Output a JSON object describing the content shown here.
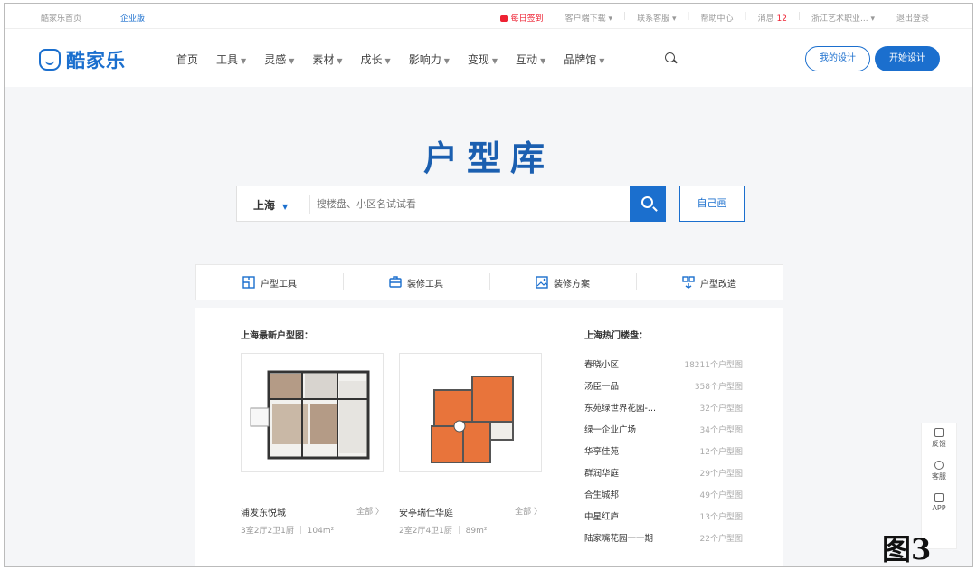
{
  "topbar": {
    "home_link": "酷家乐首页",
    "enterprise": "企业版",
    "signin": "每日签到",
    "client_download": "客户端下载",
    "contact_us": "联系客服",
    "help_center": "帮助中心",
    "messages": "消息",
    "message_count": "12",
    "account": "浙江艺术职业...",
    "logout": "退出登录"
  },
  "nav": {
    "brand": "酷家乐",
    "menu": [
      {
        "label": "首页"
      },
      {
        "label": "工具",
        "dropdown": true
      },
      {
        "label": "灵感",
        "dropdown": true
      },
      {
        "label": "素材",
        "dropdown": true
      },
      {
        "label": "成长",
        "dropdown": true
      },
      {
        "label": "影响力",
        "dropdown": true
      },
      {
        "label": "变现",
        "dropdown": true
      },
      {
        "label": "互动",
        "dropdown": true
      },
      {
        "label": "品牌馆",
        "dropdown": true
      }
    ],
    "my_design": "我的设计",
    "start_design": "开始设计"
  },
  "hero": {
    "title": "户型库",
    "city": "上海",
    "search_placeholder": "搜楼盘、小区名试试看",
    "self_draw": "自己画"
  },
  "tools": [
    {
      "label": "户型工具",
      "icon": "floorplan-icon"
    },
    {
      "label": "装修工具",
      "icon": "toolbox-icon"
    },
    {
      "label": "装修方案",
      "icon": "image-icon"
    },
    {
      "label": "户型改造",
      "icon": "renovate-icon"
    }
  ],
  "latest": {
    "title": "上海最新户型图：",
    "cards": [
      {
        "name": "浦发东悦城",
        "all": "全部 〉",
        "meta": "3室2厅2卫1厨",
        "area": "104m²"
      },
      {
        "name": "安亭瑞仕华庭",
        "all": "全部 〉",
        "meta": "2室2厅4卫1厨",
        "area": "89m²"
      }
    ]
  },
  "hot": {
    "title": "上海热门楼盘：",
    "items": [
      {
        "name": "春晓小区",
        "count": "18211个户型图"
      },
      {
        "name": "汤臣一品",
        "count": "358个户型图"
      },
      {
        "name": "东苑绿世界花园-...",
        "count": "32个户型图"
      },
      {
        "name": "绿一企业广场",
        "count": "34个户型图"
      },
      {
        "name": "华亭佳苑",
        "count": "12个户型图"
      },
      {
        "name": "群润华庭",
        "count": "29个户型图"
      },
      {
        "name": "合生城邦",
        "count": "49个户型图"
      },
      {
        "name": "中星红庐",
        "count": "13个户型图"
      },
      {
        "name": "陆家嘴花园一一期",
        "count": "22个户型图"
      }
    ]
  },
  "sidefloat": {
    "feedback": "反馈",
    "service": "客服",
    "app": "APP"
  },
  "figure_label": "图3",
  "colors": {
    "brand": "#1b6fce",
    "title": "#1b5fb0",
    "plan_orange": "#e8743b"
  }
}
